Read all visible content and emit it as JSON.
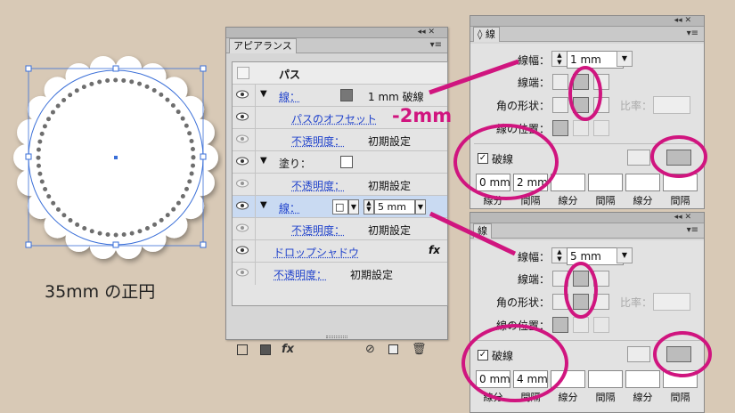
{
  "caption": "35mm の正円",
  "appearance": {
    "tab": "アピアランス",
    "header_label": "パス",
    "rows": [
      {
        "name": "線：",
        "value": "1 mm 破線"
      },
      {
        "name": "パスのオフセット"
      },
      {
        "name": "不透明度：",
        "value": "初期設定"
      },
      {
        "name": "塗り："
      },
      {
        "name": "不透明度：",
        "value": "初期設定"
      },
      {
        "name": "線：",
        "value": "5 mm"
      },
      {
        "name": "不透明度：",
        "value": "初期設定"
      },
      {
        "name": "ドロップシャドウ",
        "fx": "fx"
      },
      {
        "name": "不透明度：",
        "value": "初期設定"
      }
    ],
    "stroke_swatch_option": "□",
    "footer_fx": "fx"
  },
  "annotation": "-2mm",
  "stroke_top": {
    "tab": "線",
    "weight_label": "線幅：",
    "weight_value": "1 mm",
    "cap_label": "線端：",
    "corner_label": "角の形状：",
    "ratio_label": "比率：",
    "align_label": "線の位置：",
    "dashed_label": "破線",
    "dash_values": [
      "0 mm",
      "2 mm",
      "",
      "",
      "",
      ""
    ],
    "dash_captions": [
      "線分",
      "間隔",
      "線分",
      "間隔",
      "線分",
      "間隔"
    ]
  },
  "stroke_bottom": {
    "tab": "線",
    "weight_label": "線幅：",
    "weight_value": "5 mm",
    "cap_label": "線端：",
    "corner_label": "角の形状：",
    "ratio_label": "比率：",
    "align_label": "線の位置：",
    "dashed_label": "破線",
    "dash_values": [
      "0 mm",
      "4 mm",
      "",
      "",
      "",
      ""
    ],
    "dash_captions": [
      "線分",
      "間隔",
      "線分",
      "間隔",
      "線分",
      "間隔"
    ]
  },
  "colors": {
    "accent": "#d0157f",
    "background": "#d8c9b6",
    "link": "#2244cc"
  }
}
